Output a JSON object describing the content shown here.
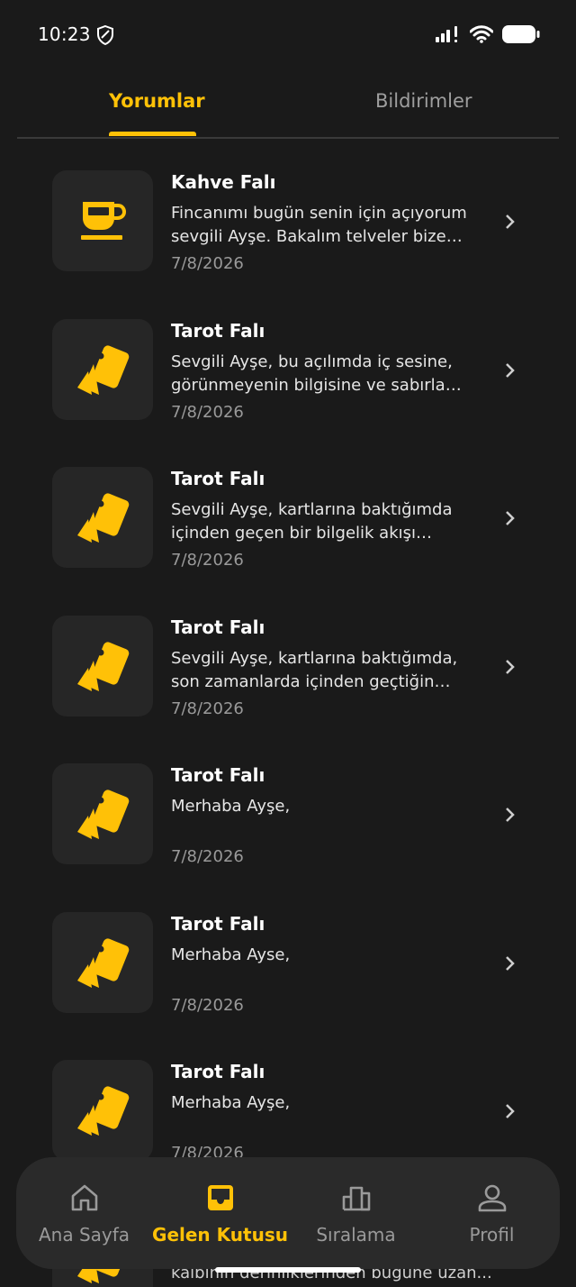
{
  "status": {
    "time": "10:23"
  },
  "tabs": [
    {
      "label": "Yorumlar",
      "active": true
    },
    {
      "label": "Bildirimler",
      "active": false
    }
  ],
  "items": [
    {
      "icon": "coffee-cup-icon",
      "title": "Kahve Falı",
      "body": "Fincanımı bugün senin için açıyorum sevgili Ayşe. Bakalım telveler bize neler anlatacak...",
      "date": "7/8/2026"
    },
    {
      "icon": "tarot-cards-icon",
      "title": "Tarot Falı",
      "body": "Sevgili Ayşe, bu açılımda iç sesine, görünmeyenin bilgisine ve sabırla gelen...",
      "date": "7/8/2026"
    },
    {
      "icon": "tarot-cards-icon",
      "title": "Tarot Falı",
      "body": "Sevgili Ayşe, kartlarına baktığımda içinden geçen bir bilgelik akışı hissediyorum...",
      "date": "7/8/2026"
    },
    {
      "icon": "tarot-cards-icon",
      "title": "Tarot Falı",
      "body": "Sevgili Ayşe, kartlarına baktığımda, son zamanlarda içinden geçtiğin yoğun...",
      "date": "7/8/2026"
    },
    {
      "icon": "tarot-cards-icon",
      "title": "Tarot Falı",
      "body": "Merhaba Ayşe,",
      "date": "7/8/2026"
    },
    {
      "icon": "tarot-cards-icon",
      "title": "Tarot Falı",
      "body": "Merhaba Ayse,",
      "date": "7/8/2026"
    },
    {
      "icon": "tarot-cards-icon",
      "title": "Tarot Falı",
      "body": "Merhaba Ayşe,",
      "date": "7/8/2026"
    }
  ],
  "peek_text": "kalbinin derinliklerinden bugüne uzan...",
  "nav": [
    {
      "label": "Ana Sayfa",
      "icon": "home-icon",
      "active": false
    },
    {
      "label": "Gelen Kutusu",
      "icon": "inbox-icon",
      "active": true
    },
    {
      "label": "Sıralama",
      "icon": "leaderboard-icon",
      "active": false
    },
    {
      "label": "Profil",
      "icon": "person-icon",
      "active": false
    }
  ],
  "colors": {
    "accent": "#FFC107",
    "background": "#1a1a1a",
    "surface": "#262626"
  }
}
